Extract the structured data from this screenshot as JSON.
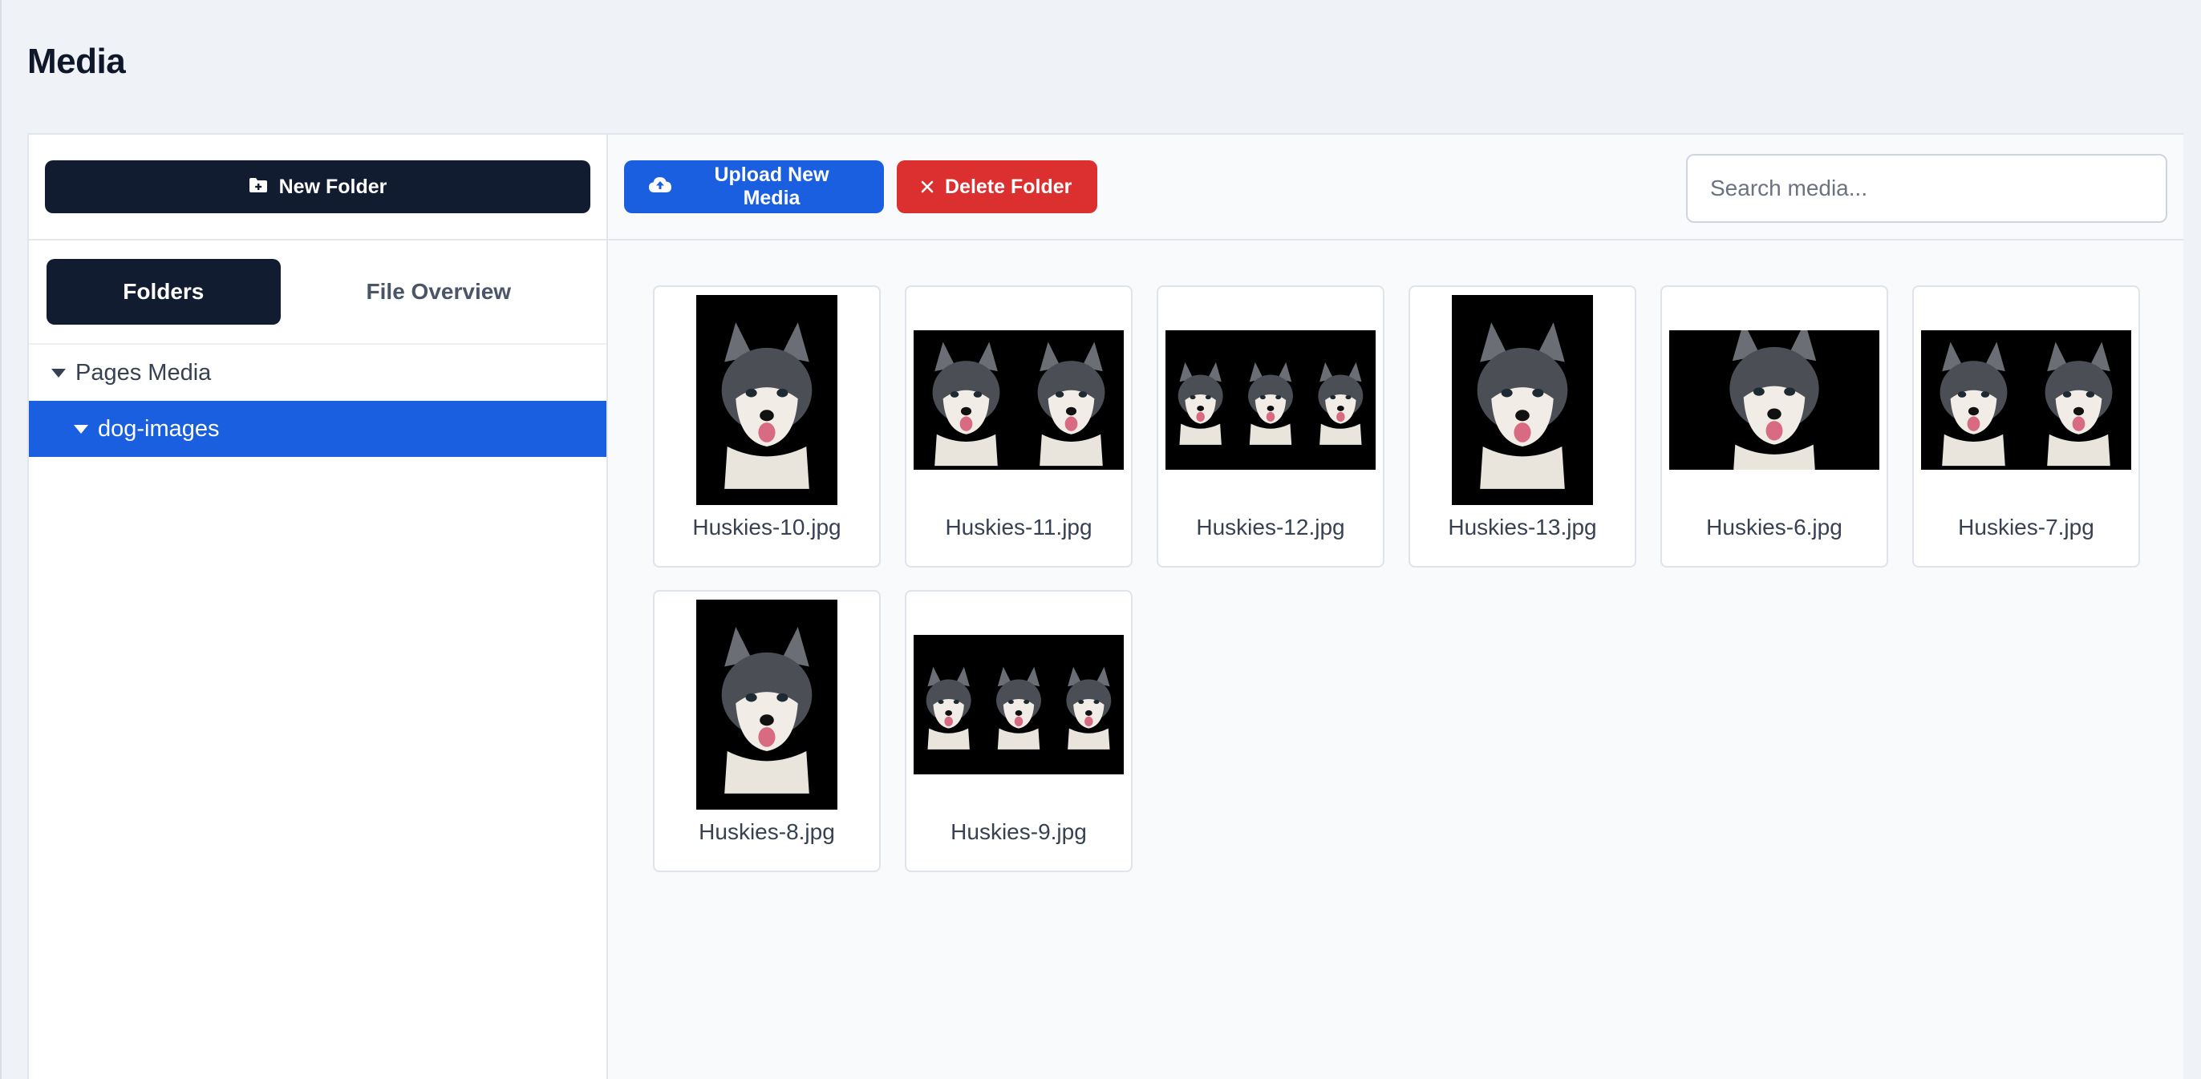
{
  "page": {
    "title": "Media"
  },
  "sidebar": {
    "new_folder_label": "New Folder",
    "tabs": [
      {
        "label": "Folders",
        "active": true
      },
      {
        "label": "File Overview",
        "active": false
      }
    ],
    "tree": {
      "root": {
        "label": "Pages Media",
        "expanded": true
      },
      "child": {
        "label": "dog-images",
        "expanded": true,
        "selected": true
      }
    }
  },
  "toolbar": {
    "upload_label": "Upload New Media",
    "delete_label": "Delete Folder",
    "search_placeholder": "Search media...",
    "search_value": ""
  },
  "media": [
    {
      "file": "Huskies-10.jpg",
      "orientation": "portrait",
      "dogs": 1
    },
    {
      "file": "Huskies-11.jpg",
      "orientation": "landscape",
      "dogs": 2
    },
    {
      "file": "Huskies-12.jpg",
      "orientation": "landscape",
      "dogs": 3
    },
    {
      "file": "Huskies-13.jpg",
      "orientation": "portrait",
      "dogs": 1
    },
    {
      "file": "Huskies-6.jpg",
      "orientation": "landscape",
      "dogs": 1
    },
    {
      "file": "Huskies-7.jpg",
      "orientation": "landscape",
      "dogs": 2
    },
    {
      "file": "Huskies-8.jpg",
      "orientation": "portrait",
      "dogs": 1
    },
    {
      "file": "Huskies-9.jpg",
      "orientation": "landscape",
      "dogs": 3
    }
  ],
  "colors": {
    "primary_dark": "#111c30",
    "primary_blue": "#1a5fe0",
    "danger_red": "#dc2f2f",
    "page_bg": "#eff2f7"
  },
  "icons": {
    "new_folder": "folder-plus-icon",
    "upload": "cloud-upload-icon",
    "delete": "close-icon",
    "tree_expanded": "caret-down-icon"
  }
}
